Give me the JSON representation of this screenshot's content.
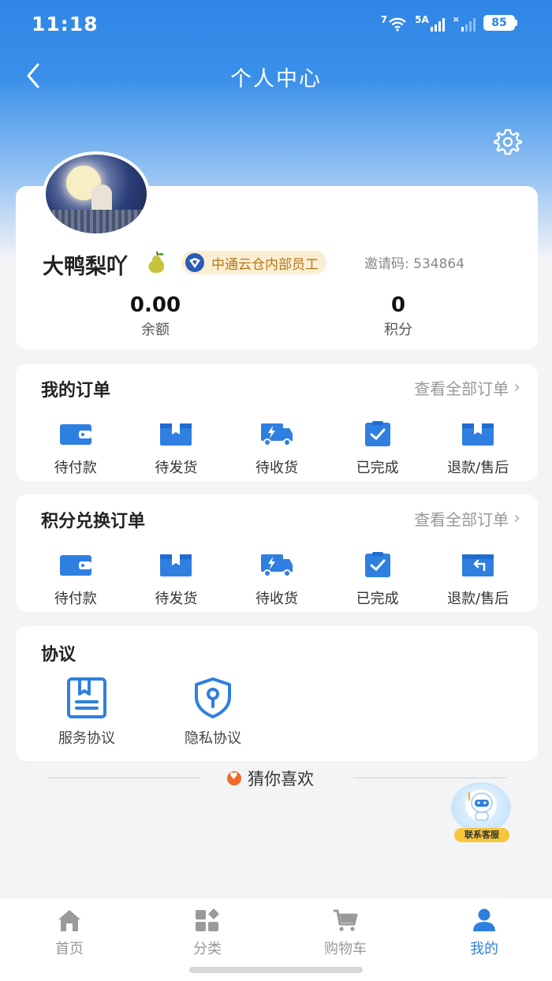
{
  "status_bar": {
    "time": "11:18",
    "wifi_label": "7",
    "network_label": "5A",
    "battery": "85"
  },
  "header": {
    "title": "个人中心",
    "back_icon": "chevron-left-icon",
    "settings_icon": "gear-icon"
  },
  "profile": {
    "name": "大鸭梨吖",
    "badge": "中通云仓内部员工",
    "invite_code": "邀请码: 534864",
    "stats": [
      {
        "value": "0.00",
        "label": "余额"
      },
      {
        "value": "0",
        "label": "积分"
      }
    ]
  },
  "orders": {
    "title": "我的订单",
    "view_all": "查看全部订单",
    "items": [
      {
        "label": "待付款",
        "icon": "wallet-icon"
      },
      {
        "label": "待发货",
        "icon": "package-icon"
      },
      {
        "label": "待收货",
        "icon": "truck-icon"
      },
      {
        "label": "已完成",
        "icon": "clipboard-check-icon"
      },
      {
        "label": "退款/售后",
        "icon": "refund-icon"
      }
    ]
  },
  "points_orders": {
    "title": "积分兑换订单",
    "view_all": "查看全部订单",
    "items": [
      {
        "label": "待付款",
        "icon": "wallet-icon"
      },
      {
        "label": "待发货",
        "icon": "package-icon"
      },
      {
        "label": "待收货",
        "icon": "truck-icon"
      },
      {
        "label": "已完成",
        "icon": "clipboard-check-icon"
      },
      {
        "label": "退款/售后",
        "icon": "refund-return-icon"
      }
    ]
  },
  "agreements": {
    "title": "协议",
    "items": [
      {
        "label": "服务协议",
        "icon": "document-icon"
      },
      {
        "label": "隐私协议",
        "icon": "shield-lock-icon"
      }
    ]
  },
  "recommend": {
    "title": "猜你喜欢"
  },
  "customer_service": {
    "label": "联系客服"
  },
  "tabbar": {
    "items": [
      {
        "label": "首页",
        "icon": "home-icon",
        "active": false
      },
      {
        "label": "分类",
        "icon": "category-icon",
        "active": false
      },
      {
        "label": "购物车",
        "icon": "cart-icon",
        "active": false
      },
      {
        "label": "我的",
        "icon": "user-icon",
        "active": true
      }
    ]
  },
  "colors": {
    "primary": "#2f7fe0",
    "header_gradient_top": "#2f86e6",
    "badge_bg": "#fbeed2",
    "badge_text": "#b07a1a"
  }
}
